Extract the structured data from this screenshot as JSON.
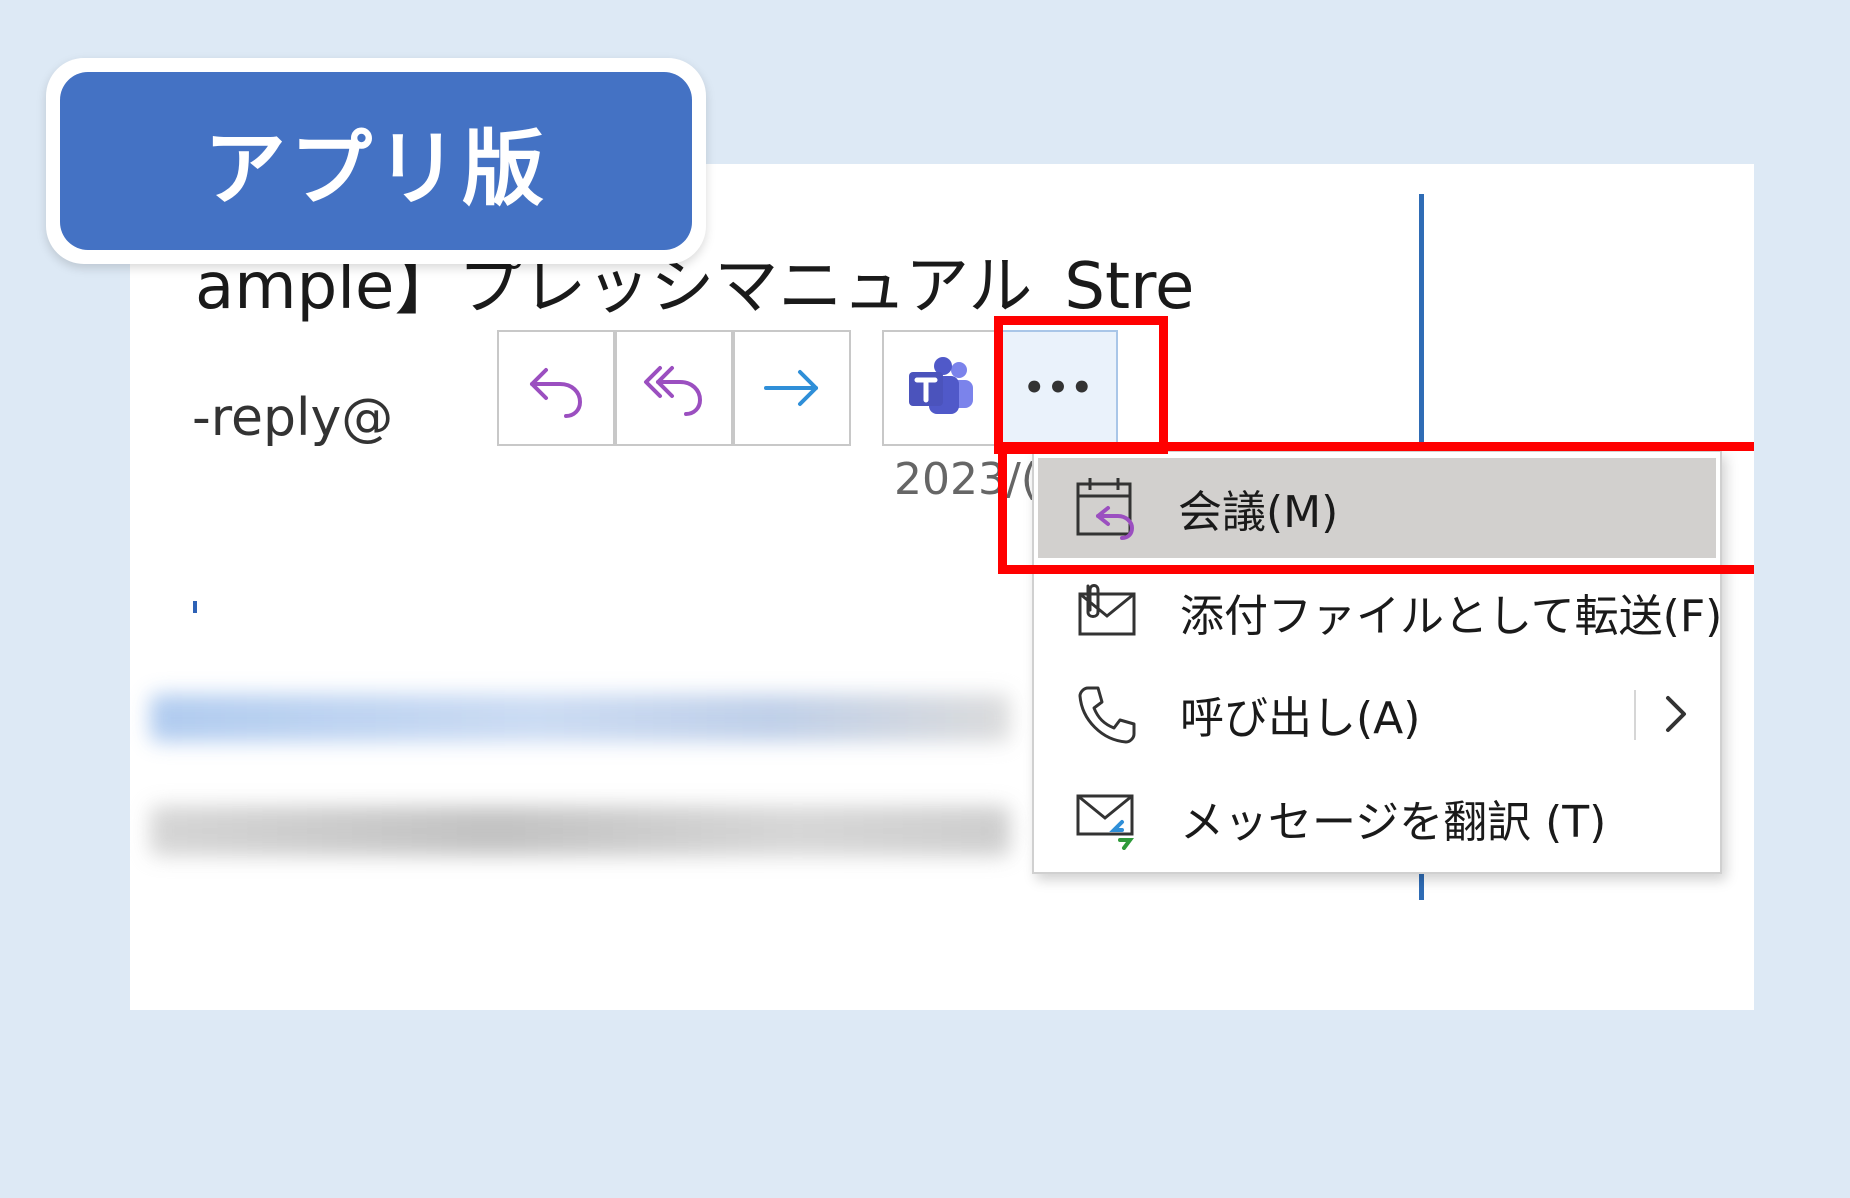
{
  "badge": {
    "label": "アプリ版"
  },
  "email": {
    "subject": "ample】プレッシマニュアル_Stre...",
    "sender": "-reply@",
    "date": "2023/("
  },
  "toolbar": {
    "reply": "reply-icon",
    "reply_all": "reply-all-icon",
    "forward": "forward-icon",
    "teams": "teams-icon",
    "more_label": "•••"
  },
  "menu": {
    "items": [
      {
        "label": "会議(M)",
        "icon": "meeting-reply-icon"
      },
      {
        "label": "添付ファイルとして転送(F)",
        "icon": "forward-as-attachment-icon"
      },
      {
        "label": "呼び出し(A)",
        "icon": "phone-icon"
      },
      {
        "label": "メッセージを翻訳 (T)",
        "icon": "translate-message-icon"
      }
    ]
  },
  "colors": {
    "background": "#dde9f5",
    "badge": "#4472c4",
    "highlight": "#ff0000",
    "reply_purple": "#9b4fc0",
    "forward_blue": "#2f8fd8",
    "selected_item": "#d2d0ce"
  }
}
